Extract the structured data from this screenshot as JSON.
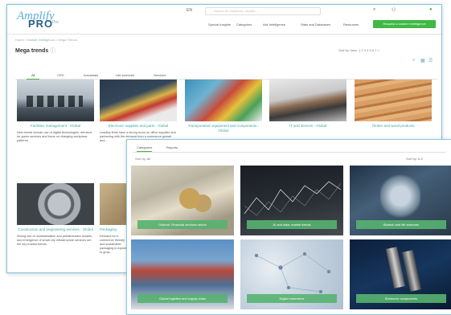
{
  "back_window": {
    "logo": {
      "script": "Amplify",
      "brand": "PRO",
      "suffix": "Pro"
    },
    "lang": "EN",
    "search": {
      "placeholder": "Search for industries, reports..."
    },
    "nav": [
      "Special Insights",
      "Categories",
      "Ask Intelligence",
      "Stats and Databases",
      "Resources"
    ],
    "request_button": "Request a custom intelligence",
    "breadcrumb": "Home > Market Intelligence > Mega Trends",
    "page_title": "Mega trends",
    "sort_label": "Sort by: New",
    "pages": "1 2 3 4 5 6 7 >",
    "tabs": [
      "All",
      "CPG",
      "Industrials",
      "Life sciences",
      "Services"
    ],
    "cards": [
      {
        "title": "Facilities management - Global",
        "desc": "New trends include use of digital technologies, demand for green services and focus on changing workplace patterns."
      },
      {
        "title": "Electronic supplies and parts - Global",
        "desc": "Leading firms have a strong focus on office supplies and partnering with the demand from e-commerce growth and..."
      },
      {
        "title": "Transportation equipment and components - Global",
        "desc": ""
      },
      {
        "title": "IT and devices - Global",
        "desc": ""
      },
      {
        "title": "Timber and wood products",
        "desc": ""
      },
      {
        "title": "Construction and engineering services - Global",
        "desc": "Strong use of modularisation and prefabrication models, and emergence of smart city infrastructure services are the key market trends."
      },
      {
        "title": "Packaging",
        "desc": "Demand for e-commerce friendly and sustainable packaging is expected to grow..."
      }
    ]
  },
  "front_window": {
    "tabs": [
      "Categories",
      "Reports"
    ],
    "sort": "Sort by: All",
    "controls": "Sort by: A-Z",
    "tiles": [
      {
        "caption": "Outlook: Financial services sector"
      },
      {
        "caption": "AI and data: market trends"
      },
      {
        "caption": "Biotech and life sciences"
      },
      {
        "caption": "Global logistics and supply chain"
      },
      {
        "caption": "Digital commerce"
      },
      {
        "caption": "Electronic components"
      }
    ]
  },
  "colors": {
    "accent_green": "#3fb845",
    "title_teal": "#3fa6a4",
    "border_blue": "#7ec3df"
  }
}
